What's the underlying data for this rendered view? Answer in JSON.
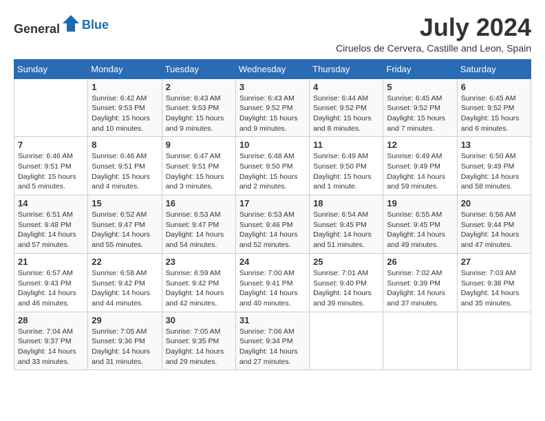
{
  "header": {
    "logo_general": "General",
    "logo_blue": "Blue",
    "month_year": "July 2024",
    "location": "Ciruelos de Cervera, Castille and Leon, Spain"
  },
  "days_of_week": [
    "Sunday",
    "Monday",
    "Tuesday",
    "Wednesday",
    "Thursday",
    "Friday",
    "Saturday"
  ],
  "weeks": [
    [
      {
        "day": "",
        "sunrise": "",
        "sunset": "",
        "daylight": ""
      },
      {
        "day": "1",
        "sunrise": "Sunrise: 6:42 AM",
        "sunset": "Sunset: 9:53 PM",
        "daylight": "Daylight: 15 hours and 10 minutes."
      },
      {
        "day": "2",
        "sunrise": "Sunrise: 6:43 AM",
        "sunset": "Sunset: 9:53 PM",
        "daylight": "Daylight: 15 hours and 9 minutes."
      },
      {
        "day": "3",
        "sunrise": "Sunrise: 6:43 AM",
        "sunset": "Sunset: 9:52 PM",
        "daylight": "Daylight: 15 hours and 9 minutes."
      },
      {
        "day": "4",
        "sunrise": "Sunrise: 6:44 AM",
        "sunset": "Sunset: 9:52 PM",
        "daylight": "Daylight: 15 hours and 8 minutes."
      },
      {
        "day": "5",
        "sunrise": "Sunrise: 6:45 AM",
        "sunset": "Sunset: 9:52 PM",
        "daylight": "Daylight: 15 hours and 7 minutes."
      },
      {
        "day": "6",
        "sunrise": "Sunrise: 6:45 AM",
        "sunset": "Sunset: 9:52 PM",
        "daylight": "Daylight: 15 hours and 6 minutes."
      }
    ],
    [
      {
        "day": "7",
        "sunrise": "Sunrise: 6:46 AM",
        "sunset": "Sunset: 9:51 PM",
        "daylight": "Daylight: 15 hours and 5 minutes."
      },
      {
        "day": "8",
        "sunrise": "Sunrise: 6:46 AM",
        "sunset": "Sunset: 9:51 PM",
        "daylight": "Daylight: 15 hours and 4 minutes."
      },
      {
        "day": "9",
        "sunrise": "Sunrise: 6:47 AM",
        "sunset": "Sunset: 9:51 PM",
        "daylight": "Daylight: 15 hours and 3 minutes."
      },
      {
        "day": "10",
        "sunrise": "Sunrise: 6:48 AM",
        "sunset": "Sunset: 9:50 PM",
        "daylight": "Daylight: 15 hours and 2 minutes."
      },
      {
        "day": "11",
        "sunrise": "Sunrise: 6:49 AM",
        "sunset": "Sunset: 9:50 PM",
        "daylight": "Daylight: 15 hours and 1 minute."
      },
      {
        "day": "12",
        "sunrise": "Sunrise: 6:49 AM",
        "sunset": "Sunset: 9:49 PM",
        "daylight": "Daylight: 14 hours and 59 minutes."
      },
      {
        "day": "13",
        "sunrise": "Sunrise: 6:50 AM",
        "sunset": "Sunset: 9:49 PM",
        "daylight": "Daylight: 14 hours and 58 minutes."
      }
    ],
    [
      {
        "day": "14",
        "sunrise": "Sunrise: 6:51 AM",
        "sunset": "Sunset: 9:48 PM",
        "daylight": "Daylight: 14 hours and 57 minutes."
      },
      {
        "day": "15",
        "sunrise": "Sunrise: 6:52 AM",
        "sunset": "Sunset: 9:47 PM",
        "daylight": "Daylight: 14 hours and 55 minutes."
      },
      {
        "day": "16",
        "sunrise": "Sunrise: 6:53 AM",
        "sunset": "Sunset: 9:47 PM",
        "daylight": "Daylight: 14 hours and 54 minutes."
      },
      {
        "day": "17",
        "sunrise": "Sunrise: 6:53 AM",
        "sunset": "Sunset: 9:46 PM",
        "daylight": "Daylight: 14 hours and 52 minutes."
      },
      {
        "day": "18",
        "sunrise": "Sunrise: 6:54 AM",
        "sunset": "Sunset: 9:45 PM",
        "daylight": "Daylight: 14 hours and 51 minutes."
      },
      {
        "day": "19",
        "sunrise": "Sunrise: 6:55 AM",
        "sunset": "Sunset: 9:45 PM",
        "daylight": "Daylight: 14 hours and 49 minutes."
      },
      {
        "day": "20",
        "sunrise": "Sunrise: 6:56 AM",
        "sunset": "Sunset: 9:44 PM",
        "daylight": "Daylight: 14 hours and 47 minutes."
      }
    ],
    [
      {
        "day": "21",
        "sunrise": "Sunrise: 6:57 AM",
        "sunset": "Sunset: 9:43 PM",
        "daylight": "Daylight: 14 hours and 46 minutes."
      },
      {
        "day": "22",
        "sunrise": "Sunrise: 6:58 AM",
        "sunset": "Sunset: 9:42 PM",
        "daylight": "Daylight: 14 hours and 44 minutes."
      },
      {
        "day": "23",
        "sunrise": "Sunrise: 6:59 AM",
        "sunset": "Sunset: 9:42 PM",
        "daylight": "Daylight: 14 hours and 42 minutes."
      },
      {
        "day": "24",
        "sunrise": "Sunrise: 7:00 AM",
        "sunset": "Sunset: 9:41 PM",
        "daylight": "Daylight: 14 hours and 40 minutes."
      },
      {
        "day": "25",
        "sunrise": "Sunrise: 7:01 AM",
        "sunset": "Sunset: 9:40 PM",
        "daylight": "Daylight: 14 hours and 39 minutes."
      },
      {
        "day": "26",
        "sunrise": "Sunrise: 7:02 AM",
        "sunset": "Sunset: 9:39 PM",
        "daylight": "Daylight: 14 hours and 37 minutes."
      },
      {
        "day": "27",
        "sunrise": "Sunrise: 7:03 AM",
        "sunset": "Sunset: 9:38 PM",
        "daylight": "Daylight: 14 hours and 35 minutes."
      }
    ],
    [
      {
        "day": "28",
        "sunrise": "Sunrise: 7:04 AM",
        "sunset": "Sunset: 9:37 PM",
        "daylight": "Daylight: 14 hours and 33 minutes."
      },
      {
        "day": "29",
        "sunrise": "Sunrise: 7:05 AM",
        "sunset": "Sunset: 9:36 PM",
        "daylight": "Daylight: 14 hours and 31 minutes."
      },
      {
        "day": "30",
        "sunrise": "Sunrise: 7:05 AM",
        "sunset": "Sunset: 9:35 PM",
        "daylight": "Daylight: 14 hours and 29 minutes."
      },
      {
        "day": "31",
        "sunrise": "Sunrise: 7:06 AM",
        "sunset": "Sunset: 9:34 PM",
        "daylight": "Daylight: 14 hours and 27 minutes."
      },
      {
        "day": "",
        "sunrise": "",
        "sunset": "",
        "daylight": ""
      },
      {
        "day": "",
        "sunrise": "",
        "sunset": "",
        "daylight": ""
      },
      {
        "day": "",
        "sunrise": "",
        "sunset": "",
        "daylight": ""
      }
    ]
  ]
}
